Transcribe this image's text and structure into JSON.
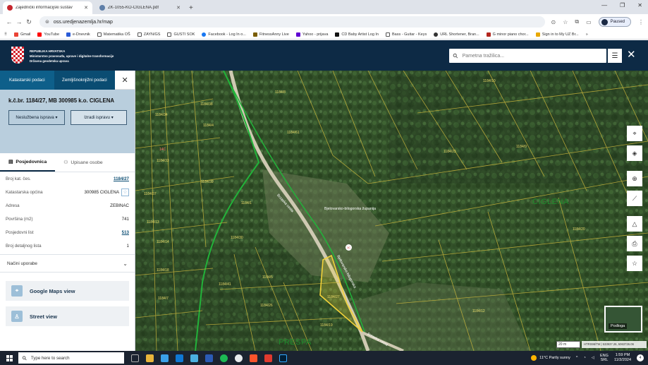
{
  "browser": {
    "tabs": [
      {
        "label": "Zajednički informacijski sustav",
        "active": true
      },
      {
        "label": "ZK-1055-KO-CIGLENA.pdf",
        "active": false
      }
    ],
    "new_tab": "+",
    "url": "oss.uredjenazemlja.hr/map",
    "paused_label": "Paused",
    "bookmarks": [
      "Gmail",
      "YouTube",
      "e-Dnevnik",
      "Matematika OŠ",
      "ZAYN/GS",
      "GUSTI SOK",
      "Facebook - Log In o...",
      "FitnessAnny Live",
      "Yahoo - prijava",
      "CD Baby Artist Log In",
      "Bass - Guitar - Keys",
      "URL Shortener, Bran...",
      "G minor piano chor...",
      "Sign in to My UZ Br..."
    ],
    "more_bookmarks": "»"
  },
  "header": {
    "line1": "REPUBLIKA HRVATSKA",
    "line2": "Ministarstvo pravosuđa, uprave i digitalne transformacije",
    "line3": "Državna geodetska uprava",
    "search_placeholder": "Pametna tražilica...",
    "close": "✕"
  },
  "sidebar": {
    "tabs": [
      "Katastarski podaci",
      "Zemljišnoknjižni podaci"
    ],
    "close": "✕",
    "parcel_title": "k.č.br. 1184/27, MB 300985 k.o. CIGLENA",
    "btn_unofficial": "Neslužbena isprava ▾",
    "btn_issue": "Izradi ispravu ▾",
    "subtabs": [
      "Posjedovnica",
      "Upisane osobe"
    ],
    "rows": [
      {
        "label": "Broj kat. čes.",
        "value": "1184/27",
        "link": true
      },
      {
        "label": "Katastarska općina",
        "value": "300985 CIGLENA",
        "star": true
      },
      {
        "label": "Adresa",
        "value": "ZEBINAC"
      },
      {
        "label": "Površina (m2)",
        "value": "741"
      },
      {
        "label": "Posjedovni list",
        "value": "513",
        "link": true
      },
      {
        "label": "Broj detaljnog lista",
        "value": "1"
      }
    ],
    "usage_label": "Načini uporabe",
    "google_maps": "Google Maps view",
    "street_view": "Street view"
  },
  "map": {
    "place_names": [
      "CIGLENA",
      "PRESPA"
    ],
    "road_labels": [
      "Brzaska cesta",
      "Bjelovarsko-bilogorska županija",
      "Bjelovarsko-bilogorska",
      "Brzaska cesta"
    ],
    "parcel_labels": [
      "1184/8",
      "1184/10",
      "1184/9",
      "1184/23",
      "1184/20",
      "1184/27",
      "1184/12",
      "1184/34",
      "1184/33",
      "1184/37",
      "1184/13",
      "1184/14",
      "1184/18",
      "1184/38",
      "1184/4",
      "1184/7",
      "1184/41",
      "1184/30",
      "1184/1",
      "1184/5",
      "1184/26",
      "1184/19",
      "1184/39",
      "1184/61"
    ],
    "pin_label": "1C",
    "tick_label": "14C",
    "scale": "20 m",
    "coords": "HTRS96/TM | 533937.26, 5063726.06",
    "basemap_label": "Podloga"
  },
  "taskbar": {
    "search_placeholder": "Type here to search",
    "weather": "11°C  Partly sunny",
    "lang1": "ENG",
    "lang2": "SRL",
    "time": "1:59 PM",
    "date": "11/3/2024",
    "notif": "4"
  }
}
